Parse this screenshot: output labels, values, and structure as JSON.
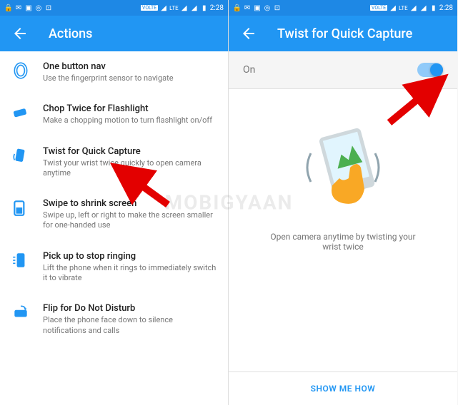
{
  "status": {
    "time": "2:28",
    "lte": "LTE",
    "volte": "VOLTE"
  },
  "left": {
    "title": "Actions",
    "items": [
      {
        "title": "One button nav",
        "subtitle": "Use the fingerprint sensor to navigate"
      },
      {
        "title": "Chop Twice for Flashlight",
        "subtitle": "Make a chopping motion to turn flashlight on/off"
      },
      {
        "title": "Twist for Quick Capture",
        "subtitle": "Twist your wrist twice quickly to open camera anytime"
      },
      {
        "title": "Swipe to shrink screen",
        "subtitle": "Swipe up, left or right to make the screen smaller for one-handed use"
      },
      {
        "title": "Pick up to stop ringing",
        "subtitle": "Lift the phone when it rings to immediately switch it to vibrate"
      },
      {
        "title": "Flip for Do Not Disturb",
        "subtitle": "Place the phone face down to silence notifications and calls"
      }
    ]
  },
  "right": {
    "title": "Twist for Quick Capture",
    "toggle_label": "On",
    "description": "Open camera anytime by twisting your wrist twice",
    "button": "SHOW ME HOW"
  },
  "watermark": "MOBIGYAAN"
}
